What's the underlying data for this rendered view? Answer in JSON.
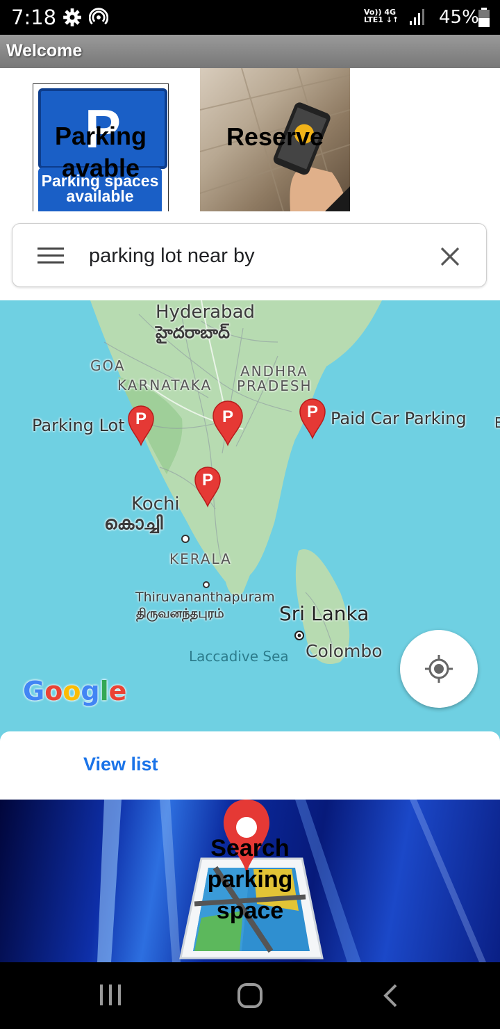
{
  "status_bar": {
    "time": "7:18",
    "network_top": "Vo)) 4G",
    "network_bottom": "LTE1 ↓↑",
    "battery_percent": "45%"
  },
  "app_bar": {
    "title": "Welcome"
  },
  "tiles": [
    {
      "label": "Parking avable",
      "sign_text": "Parking spaces available"
    },
    {
      "label": "Reserve"
    }
  ],
  "search": {
    "query": "parking lot near by"
  },
  "map": {
    "labels": {
      "hyderabad": "Hyderabad",
      "hyderabad_te": "హైదరాబాద్",
      "goa": "GOA",
      "karnataka": "KARNATAKA",
      "andhra": "ANDHRA",
      "pradesh": "PRADESH",
      "kochi": "Kochi",
      "kochi_ml": "കൊച്ചി",
      "kerala": "KERALA",
      "thiruvananthapuram": "Thiruvananthapuram",
      "thiruvananthapuram_ta": "திருவனந்தபுரம்",
      "sri_lanka": "Sri Lanka",
      "colombo": "Colombo",
      "laccadive_sea": "Laccadive Sea",
      "edge": "E"
    },
    "markers": [
      {
        "name": "Parking Lot",
        "glyph": "P"
      },
      {
        "name": "",
        "glyph": "P"
      },
      {
        "name": "Paid Car Parking",
        "glyph": "P"
      },
      {
        "name": "",
        "glyph": "P"
      }
    ],
    "logo": "Google"
  },
  "bottom_sheet": {
    "view_list": "View list"
  },
  "banner": {
    "label": "Search parking space"
  },
  "colors": {
    "map_water": "#6fd0e2",
    "marker": "#e53935",
    "link": "#1a73e8"
  }
}
